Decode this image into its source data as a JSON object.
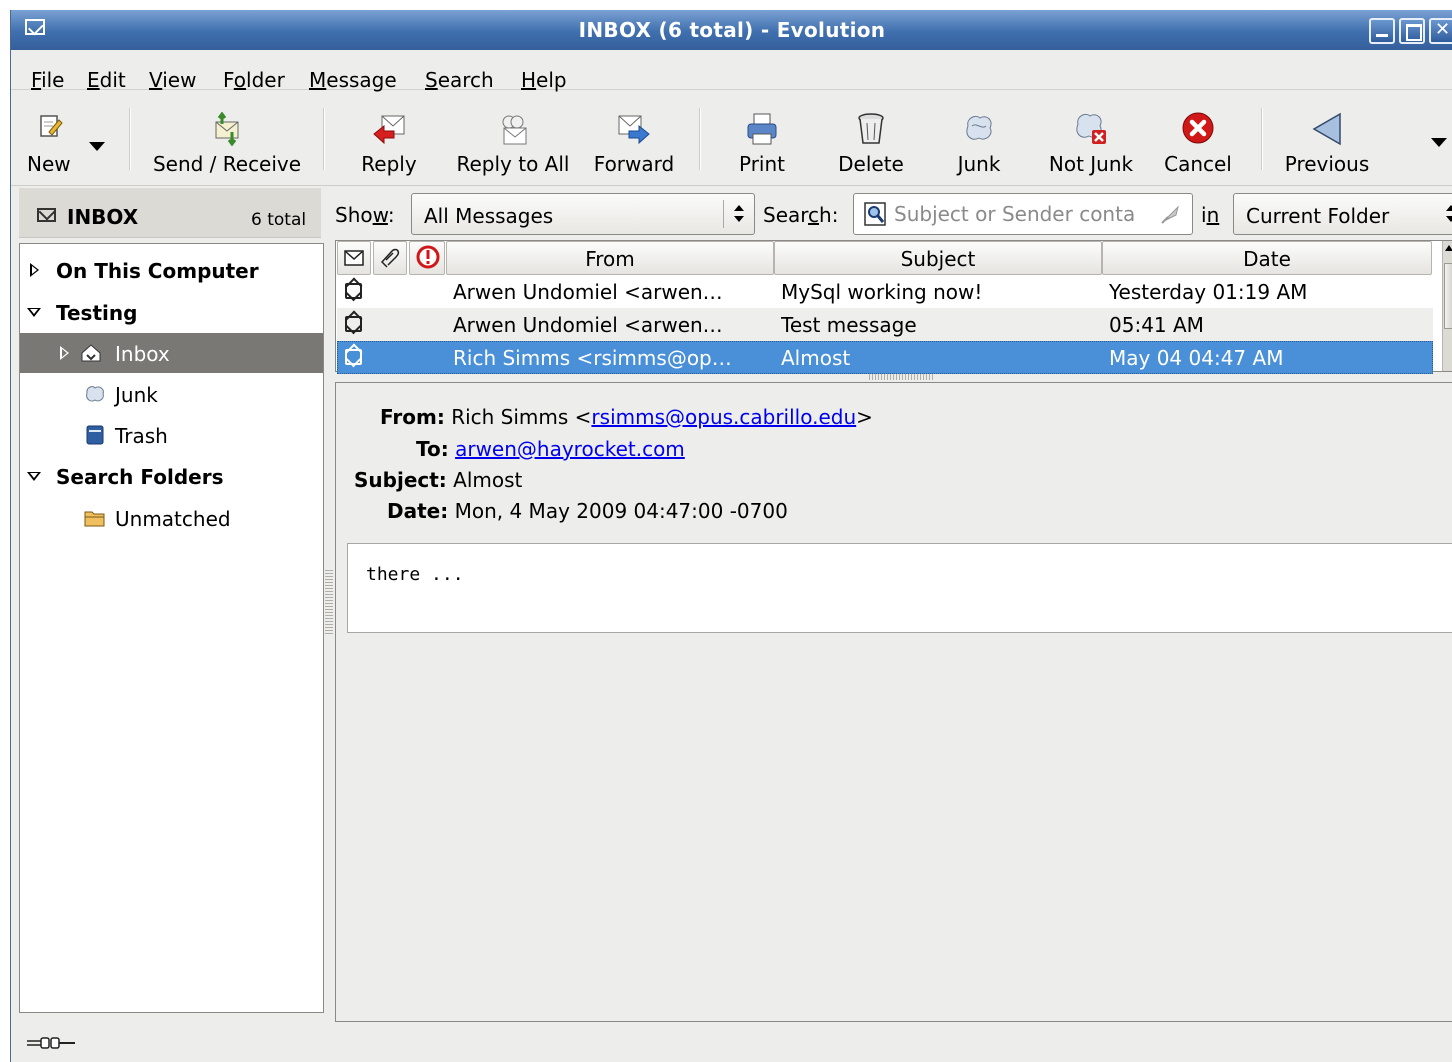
{
  "window": {
    "title": "INBOX (6 total) - Evolution"
  },
  "menu": [
    {
      "label": "File",
      "mnemonic": "F",
      "rest": "ile"
    },
    {
      "label": "Edit",
      "mnemonic": "E",
      "rest": "dit"
    },
    {
      "label": "View",
      "mnemonic": "V",
      "rest": "iew"
    },
    {
      "label": "Folder",
      "mnemonic": "o",
      "pre": "F",
      "rest": "lder"
    },
    {
      "label": "Message",
      "mnemonic": "M",
      "rest": "essage"
    },
    {
      "label": "Search",
      "mnemonic": "S",
      "rest": "earch"
    },
    {
      "label": "Help",
      "mnemonic": "H",
      "rest": "elp"
    }
  ],
  "toolbar": {
    "new": "New",
    "send_receive": "Send / Receive",
    "reply": "Reply",
    "reply_all": "Reply to All",
    "forward": "Forward",
    "print": "Print",
    "delete": "Delete",
    "junk": "Junk",
    "not_junk": "Not Junk",
    "cancel": "Cancel",
    "previous": "Previous"
  },
  "folder_header": {
    "name": "INBOX",
    "count": "6 total"
  },
  "tree": {
    "on_this_computer": "On This Computer",
    "testing": "Testing",
    "inbox": "Inbox",
    "junk": "Junk",
    "trash": "Trash",
    "search_folders": "Search Folders",
    "unmatched": "Unmatched"
  },
  "searchbar": {
    "show_label_pre": "Sho",
    "show_label_mn": "w",
    "show_label_post": ":",
    "show_value": "All Messages",
    "search_label_pre": "Sear",
    "search_label_mn": "c",
    "search_label_post": "h:",
    "search_placeholder": "Subject or Sender conta",
    "in_label_pre": "i",
    "in_label_mn": "n",
    "scope_value": "Current Folder"
  },
  "columns": {
    "from": "From",
    "subject": "Subject",
    "date": "Date"
  },
  "messages": [
    {
      "from": "Arwen Undomiel <arwen…",
      "subject": "MySql working now!",
      "date": "Yesterday 01:19 AM"
    },
    {
      "from": "Arwen Undomiel <arwen…",
      "subject": "Test message",
      "date": "05:41 AM"
    },
    {
      "from": "Rich Simms <rsimms@op…",
      "subject": "Almost",
      "date": "May 04 04:47 AM"
    }
  ],
  "preview": {
    "from_label": "From:",
    "from_name": "Rich Simms <",
    "from_email": "rsimms@opus.cabrillo.edu",
    "from_close": ">",
    "to_label": "To:",
    "to_email": "arwen@hayrocket.com",
    "subject_label": "Subject:",
    "subject": "Almost",
    "date_label": "Date:",
    "date": "Mon, 4 May 2009 04:47:00 -0700",
    "body": "there ..."
  },
  "colors": {
    "selection": "#4a90d9",
    "titlebar": "#3f6fae",
    "tree_selected": "#797874"
  }
}
